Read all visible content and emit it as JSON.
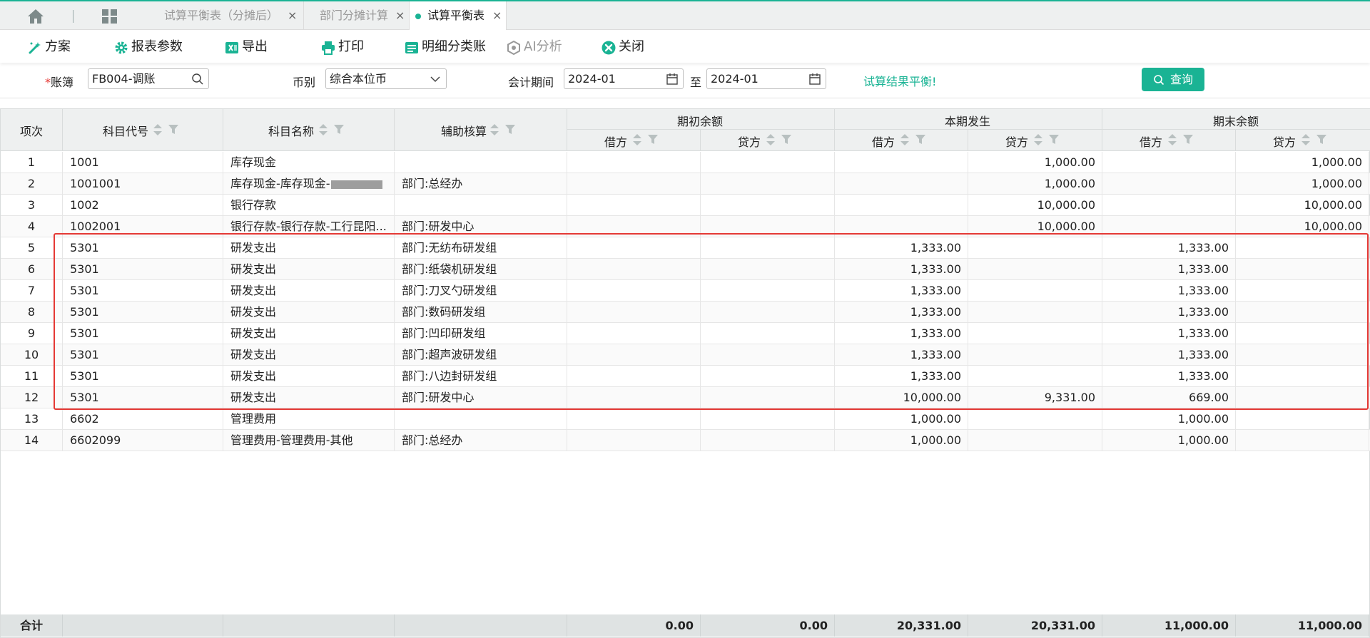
{
  "colors": {
    "accent": "#1ab394",
    "highlight": "#e53935",
    "header_bg": "#eef0f0"
  },
  "tabs": [
    {
      "label": "试算平衡表（分摊后）",
      "close": "×",
      "active": false
    },
    {
      "label": "部门分摊计算",
      "close": "×",
      "active": false
    },
    {
      "label": "试算平衡表",
      "close": "×",
      "active": true
    }
  ],
  "tab_icons": {
    "home": "home-icon",
    "apps": "grid-icon"
  },
  "toolbar": {
    "plan": "方案",
    "report_params": "报表参数",
    "export": "导出",
    "print": "打印",
    "detail_ledger": "明细分类账",
    "ai_analysis": "AI分析",
    "close": "关闭"
  },
  "filters": {
    "ledger_label": "账簿",
    "ledger_required_mark": "*",
    "ledger_value": "FB004-调账",
    "currency_label": "币别",
    "currency_value": "综合本位币",
    "period_label": "会计期间",
    "period_from": "2024-01",
    "period_to_label": "至",
    "period_to": "2024-01",
    "balance_message": "试算结果平衡!",
    "query_button": "查询"
  },
  "table": {
    "headers": {
      "seq": "项次",
      "code": "科目代号",
      "name": "科目名称",
      "aux": "辅助核算",
      "opening": "期初余额",
      "current": "本期发生",
      "closing": "期末余额",
      "debit": "借方",
      "credit": "贷方"
    },
    "rows": [
      {
        "seq": "1",
        "code": "1001",
        "name": "库存现金",
        "aux": "",
        "od": "",
        "oc": "",
        "cd": "",
        "cc": "1,000.00",
        "ed": "",
        "ec": "1,000.00"
      },
      {
        "seq": "2",
        "code": "1001001",
        "name": "库存现金-库存现金-",
        "aux": "部门:总经办",
        "od": "",
        "oc": "",
        "cd": "",
        "cc": "1,000.00",
        "ed": "",
        "ec": "1,000.00"
      },
      {
        "seq": "3",
        "code": "1002",
        "name": "银行存款",
        "aux": "",
        "od": "",
        "oc": "",
        "cd": "",
        "cc": "10,000.00",
        "ed": "",
        "ec": "10,000.00"
      },
      {
        "seq": "4",
        "code": "1002001",
        "name": "银行存款-银行存款-工行昆阳...",
        "aux": "部门:研发中心",
        "od": "",
        "oc": "",
        "cd": "",
        "cc": "10,000.00",
        "ed": "",
        "ec": "10,000.00"
      },
      {
        "seq": "5",
        "code": "5301",
        "name": "研发支出",
        "aux": "部门:无纺布研发组",
        "od": "",
        "oc": "",
        "cd": "1,333.00",
        "cc": "",
        "ed": "1,333.00",
        "ec": ""
      },
      {
        "seq": "6",
        "code": "5301",
        "name": "研发支出",
        "aux": "部门:纸袋机研发组",
        "od": "",
        "oc": "",
        "cd": "1,333.00",
        "cc": "",
        "ed": "1,333.00",
        "ec": ""
      },
      {
        "seq": "7",
        "code": "5301",
        "name": "研发支出",
        "aux": "部门:刀叉勺研发组",
        "od": "",
        "oc": "",
        "cd": "1,333.00",
        "cc": "",
        "ed": "1,333.00",
        "ec": ""
      },
      {
        "seq": "8",
        "code": "5301",
        "name": "研发支出",
        "aux": "部门:数码研发组",
        "od": "",
        "oc": "",
        "cd": "1,333.00",
        "cc": "",
        "ed": "1,333.00",
        "ec": ""
      },
      {
        "seq": "9",
        "code": "5301",
        "name": "研发支出",
        "aux": "部门:凹印研发组",
        "od": "",
        "oc": "",
        "cd": "1,333.00",
        "cc": "",
        "ed": "1,333.00",
        "ec": ""
      },
      {
        "seq": "10",
        "code": "5301",
        "name": "研发支出",
        "aux": "部门:超声波研发组",
        "od": "",
        "oc": "",
        "cd": "1,333.00",
        "cc": "",
        "ed": "1,333.00",
        "ec": ""
      },
      {
        "seq": "11",
        "code": "5301",
        "name": "研发支出",
        "aux": "部门:八边封研发组",
        "od": "",
        "oc": "",
        "cd": "1,333.00",
        "cc": "",
        "ed": "1,333.00",
        "ec": ""
      },
      {
        "seq": "12",
        "code": "5301",
        "name": "研发支出",
        "aux": "部门:研发中心",
        "od": "",
        "oc": "",
        "cd": "10,000.00",
        "cc": "9,331.00",
        "ed": "669.00",
        "ec": ""
      },
      {
        "seq": "13",
        "code": "6602",
        "name": "管理费用",
        "aux": "",
        "od": "",
        "oc": "",
        "cd": "1,000.00",
        "cc": "",
        "ed": "1,000.00",
        "ec": ""
      },
      {
        "seq": "14",
        "code": "6602099",
        "name": "管理费用-管理费用-其他",
        "aux": "部门:总经办",
        "od": "",
        "oc": "",
        "cd": "1,000.00",
        "cc": "",
        "ed": "1,000.00",
        "ec": ""
      }
    ],
    "totals": {
      "label": "合计",
      "od": "0.00",
      "oc": "0.00",
      "cd": "20,331.00",
      "cc": "20,331.00",
      "ed": "11,000.00",
      "ec": "11,000.00"
    }
  }
}
